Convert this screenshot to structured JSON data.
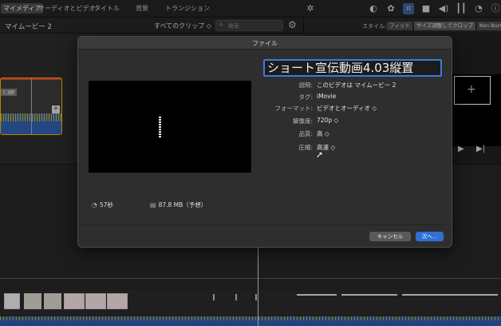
{
  "top_tabs": [
    "マイメディア",
    "オーディオとビデオ",
    "タイトル",
    "背景",
    "トランジション"
  ],
  "top_icons": [
    "magic-wand-icon",
    "color-balance-icon",
    "color-palette-icon",
    "crop-icon",
    "camera-icon",
    "volume-icon",
    "equalizer-icon",
    "speed-icon",
    "info-icon"
  ],
  "library": {
    "title": "マイムービー 2",
    "clips_filter": "すべてのクリップ ◇",
    "search_placeholder": "検索",
    "clip_duration": "7.3秒"
  },
  "viewer": {
    "style_label": "スタイル:",
    "style_options": [
      "フィット",
      "サイズ調整してクロップ",
      "Ken Burns"
    ]
  },
  "dialog": {
    "title": "ファイル",
    "name_value": "ショート宣伝動画4.03縦置",
    "fields": [
      {
        "label": "説明:",
        "value": "このビデオは マイムービー 2"
      },
      {
        "label": "タグ:",
        "value": "iMovie"
      },
      {
        "label": "フォーマット:",
        "value": "ビデオとオーディオ ◇"
      },
      {
        "label": "解像度:",
        "value": "720p ◇"
      },
      {
        "label": "品質:",
        "value": "高 ◇"
      },
      {
        "label": "圧縮:",
        "value": "高速 ◇"
      }
    ],
    "duration": "57秒",
    "filesize": "87.8 MB（予想）",
    "cancel_label": "キャンセル",
    "next_label": "次へ..."
  }
}
